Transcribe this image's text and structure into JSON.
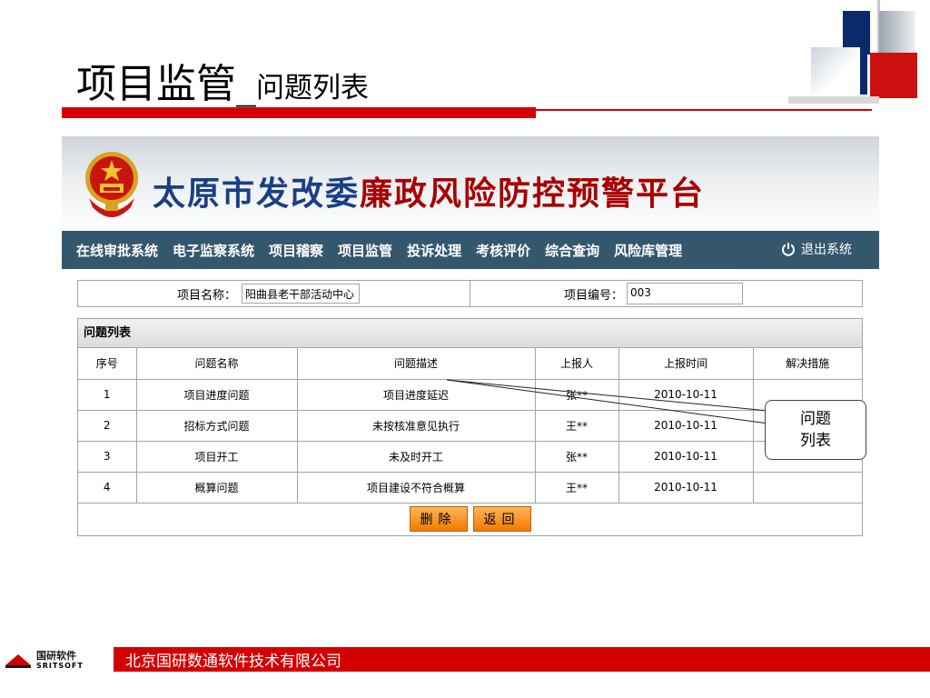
{
  "slide": {
    "title_main": "项目监管_",
    "title_sub": "问题列表"
  },
  "banner": {
    "title_blue": "太原市发改委",
    "title_red": "廉政风险防控预警平台"
  },
  "nav": {
    "items": [
      "在线审批系统",
      "电子监察系统",
      "项目稽察",
      "项目监管",
      "投诉处理",
      "考核评价",
      "综合查询",
      "风险库管理"
    ],
    "logout_label": "退出系统"
  },
  "project_info": {
    "name_label": "项目名称：",
    "name_value": "阳曲县老干部活动中心",
    "code_label": "项目编号：",
    "code_value": "003"
  },
  "problem_list": {
    "heading": "问题列表",
    "columns": [
      "序号",
      "问题名称",
      "问题描述",
      "上报人",
      "上报时间",
      "解决措施"
    ],
    "rows": [
      [
        "1",
        "项目进度问题",
        "项目进度延迟",
        "张**",
        "2010-10-11",
        ""
      ],
      [
        "2",
        "招标方式问题",
        "未按核准意见执行",
        "王**",
        "2010-10-11",
        ""
      ],
      [
        "3",
        "项目开工",
        "未及时开工",
        "张**",
        "2010-10-11",
        ""
      ],
      [
        "4",
        "概算问题",
        "项目建设不符合概算",
        "王**",
        "2010-10-11",
        ""
      ]
    ],
    "delete_label": "删除",
    "back_label": "返回"
  },
  "callout": {
    "line1": "问题",
    "line2": "列表"
  },
  "footer": {
    "company": "北京国研数通软件技术有限公司",
    "logo_cn": "国研软件",
    "logo_en": "SRITSOFT"
  },
  "colors": {
    "accent_red": "#d40000",
    "nav_bg": "#35576d",
    "banner_blue": "#1a3f86",
    "button_orange": "#f07c00"
  }
}
